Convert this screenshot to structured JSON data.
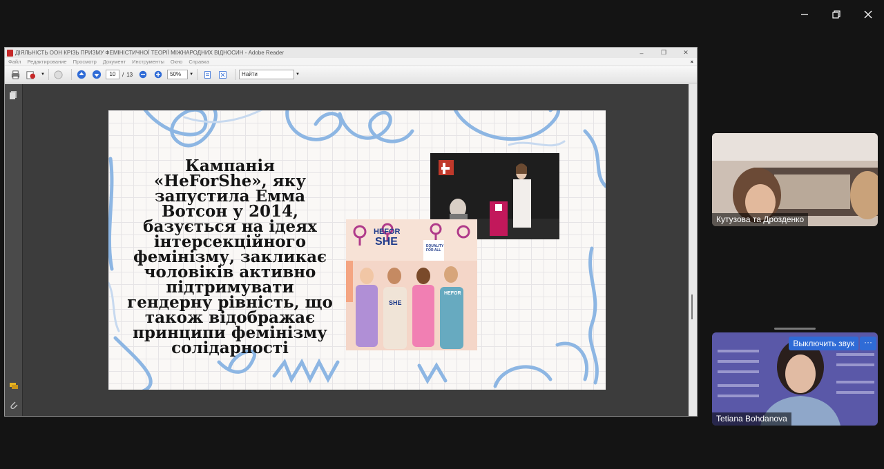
{
  "app": {
    "window_controls": [
      "minimize",
      "restore",
      "close"
    ]
  },
  "reader": {
    "title": "ДІЯЛЬНІСТЬ ООН КРІЗЬ ПРИЗМУ ФЕМІНІСТИЧНОЇ ТЕОРІЇ МІЖНАРОДНИХ ВІДНОСИН - Adobe Reader",
    "menu": [
      "Файл",
      "Редактирование",
      "Просмотр",
      "Документ",
      "Инструменты",
      "Окно",
      "Справка"
    ],
    "toolbar": {
      "page_current": "10",
      "page_separator": "/",
      "page_total": "13",
      "zoom": "50%",
      "find_placeholder": "Найти"
    }
  },
  "slide": {
    "text": "Кампанія «HeForShe», яку запустила Емма Вотсон у 2014, базується на ідеях інтерсекційного фемінізму, закликає чоловіків активно підтримувати гендерну рівність, що також відображає принципи фемінізму солідарності",
    "poster_labels": {
      "he_for": "HEFOR",
      "she": "SHE",
      "equality": "EQUALITY FOR ALL"
    }
  },
  "participants": [
    {
      "name": "Кутузова та Дрозденко"
    },
    {
      "name": "Tetiana Bohdanova",
      "mute_label": "Выключить звук",
      "more_label": "···"
    }
  ],
  "colors": {
    "accent_blue": "#2f6bd6",
    "slide_scribble": "#8db6e3"
  }
}
